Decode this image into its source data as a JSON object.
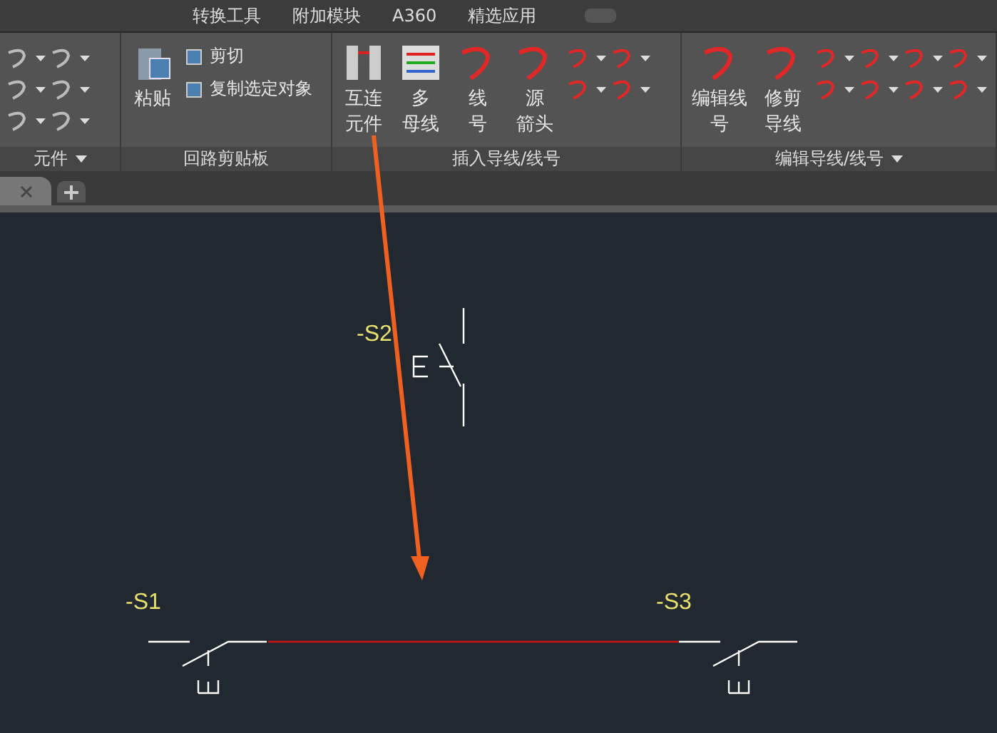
{
  "ribbon_tabs": [
    {
      "label": "转换工具",
      "selected": false
    },
    {
      "label": "附加模块",
      "selected": false
    },
    {
      "label": "A360",
      "selected": false
    },
    {
      "label": "精选应用",
      "selected": false
    }
  ],
  "panels": [
    {
      "title": "元件"
    },
    {
      "title": "回路剪贴板",
      "large_buttons": [
        {
          "lines": [
            "粘贴"
          ]
        }
      ],
      "small_buttons": [
        {
          "label": "剪切"
        },
        {
          "label": "复制选定对象"
        }
      ]
    },
    {
      "title": "插入导线/线号",
      "large_buttons": [
        {
          "lines": [
            "互连",
            "元件"
          ]
        },
        {
          "lines": [
            "多",
            "母线"
          ]
        },
        {
          "lines": [
            "线",
            "号"
          ]
        },
        {
          "lines": [
            "源",
            "箭头"
          ]
        }
      ]
    },
    {
      "title": "编辑导线/线号",
      "large_buttons": [
        {
          "lines": [
            "编辑线",
            "号"
          ]
        },
        {
          "lines": [
            "修剪",
            "导线"
          ]
        }
      ]
    }
  ],
  "drawing": {
    "labels": [
      {
        "text": "-S2"
      },
      {
        "text": "-S1"
      },
      {
        "text": "-S3"
      }
    ]
  }
}
